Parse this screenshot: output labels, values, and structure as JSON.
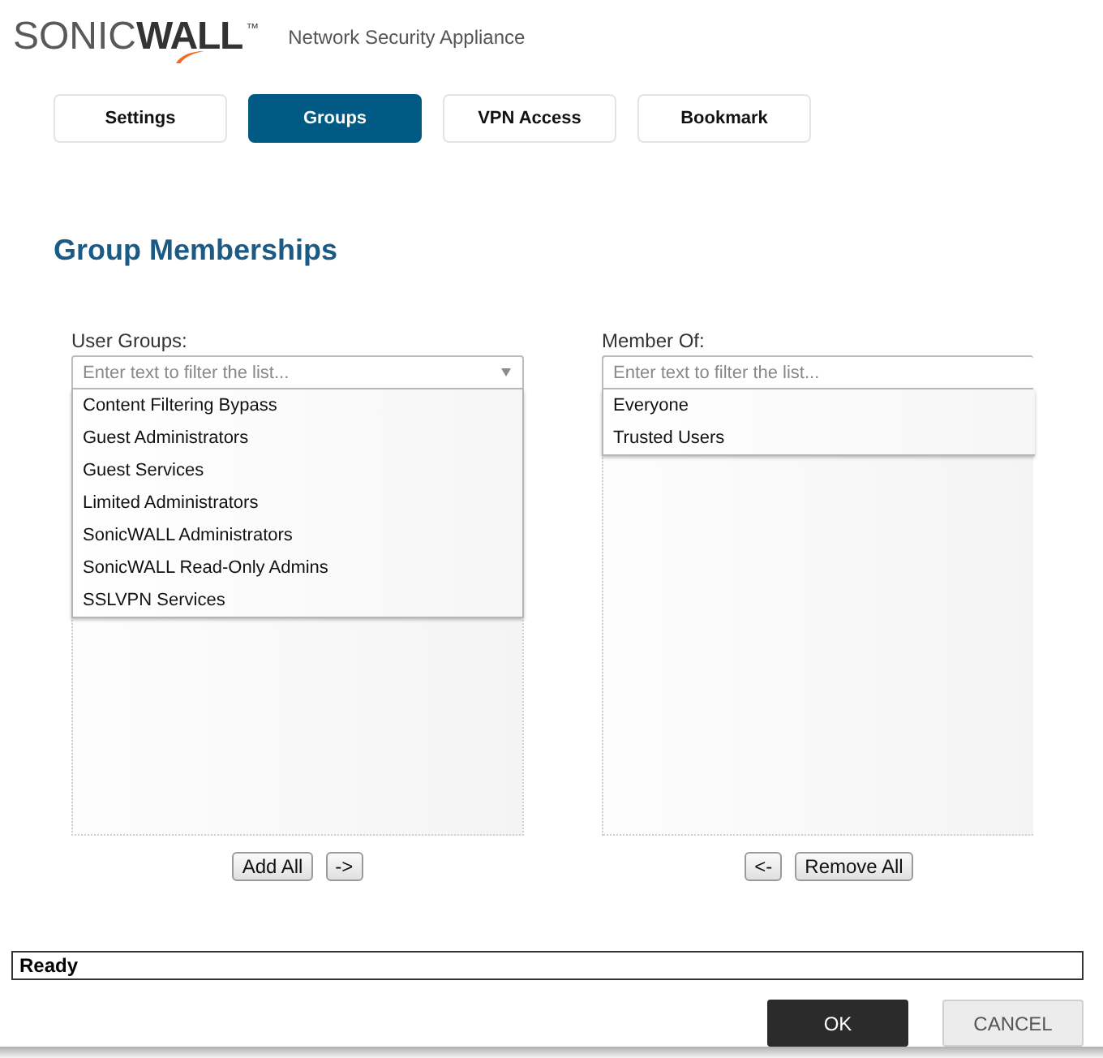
{
  "header": {
    "logo": {
      "light": "SONIC",
      "bold": "WALL",
      "mark": "™"
    },
    "subtitle": "Network Security Appliance"
  },
  "tabs": [
    {
      "label": "Settings",
      "selected": false
    },
    {
      "label": "Groups",
      "selected": true
    },
    {
      "label": "VPN Access",
      "selected": false
    },
    {
      "label": "Bookmark",
      "selected": false
    }
  ],
  "heading": "Group Memberships",
  "panels": [
    {
      "label": "User Groups:",
      "filter": {
        "placeholder": "Enter text to filter the list...",
        "caret": true
      },
      "items": [
        {
          "label": "Content Filtering Bypass",
          "selected": false
        },
        {
          "label": "Guest Administrators",
          "selected": false
        },
        {
          "label": "Guest Services",
          "selected": false
        },
        {
          "label": "Limited Administrators",
          "selected": false
        },
        {
          "label": "SonicWALL Administrators",
          "selected": false
        },
        {
          "label": "SonicWALL Read-Only Admins",
          "selected": false
        },
        {
          "label": "SSLVPN Services",
          "selected": false
        }
      ],
      "buttons": [
        "Add All",
        "->"
      ]
    },
    {
      "label": "Member Of:",
      "filter": {
        "placeholder": "Enter text to filter the list..."
      },
      "items": [
        {
          "label": "Everyone",
          "selected": false
        },
        {
          "label": "Trusted Users",
          "selected": false
        }
      ],
      "buttons": [
        "<-",
        "Remove All"
      ]
    }
  ],
  "status_bar": {
    "text": "Ready"
  },
  "dialog_buttons": [
    {
      "label": "OK",
      "kind": "primary"
    },
    {
      "label": "CANCEL",
      "kind": "secondary"
    }
  ]
}
